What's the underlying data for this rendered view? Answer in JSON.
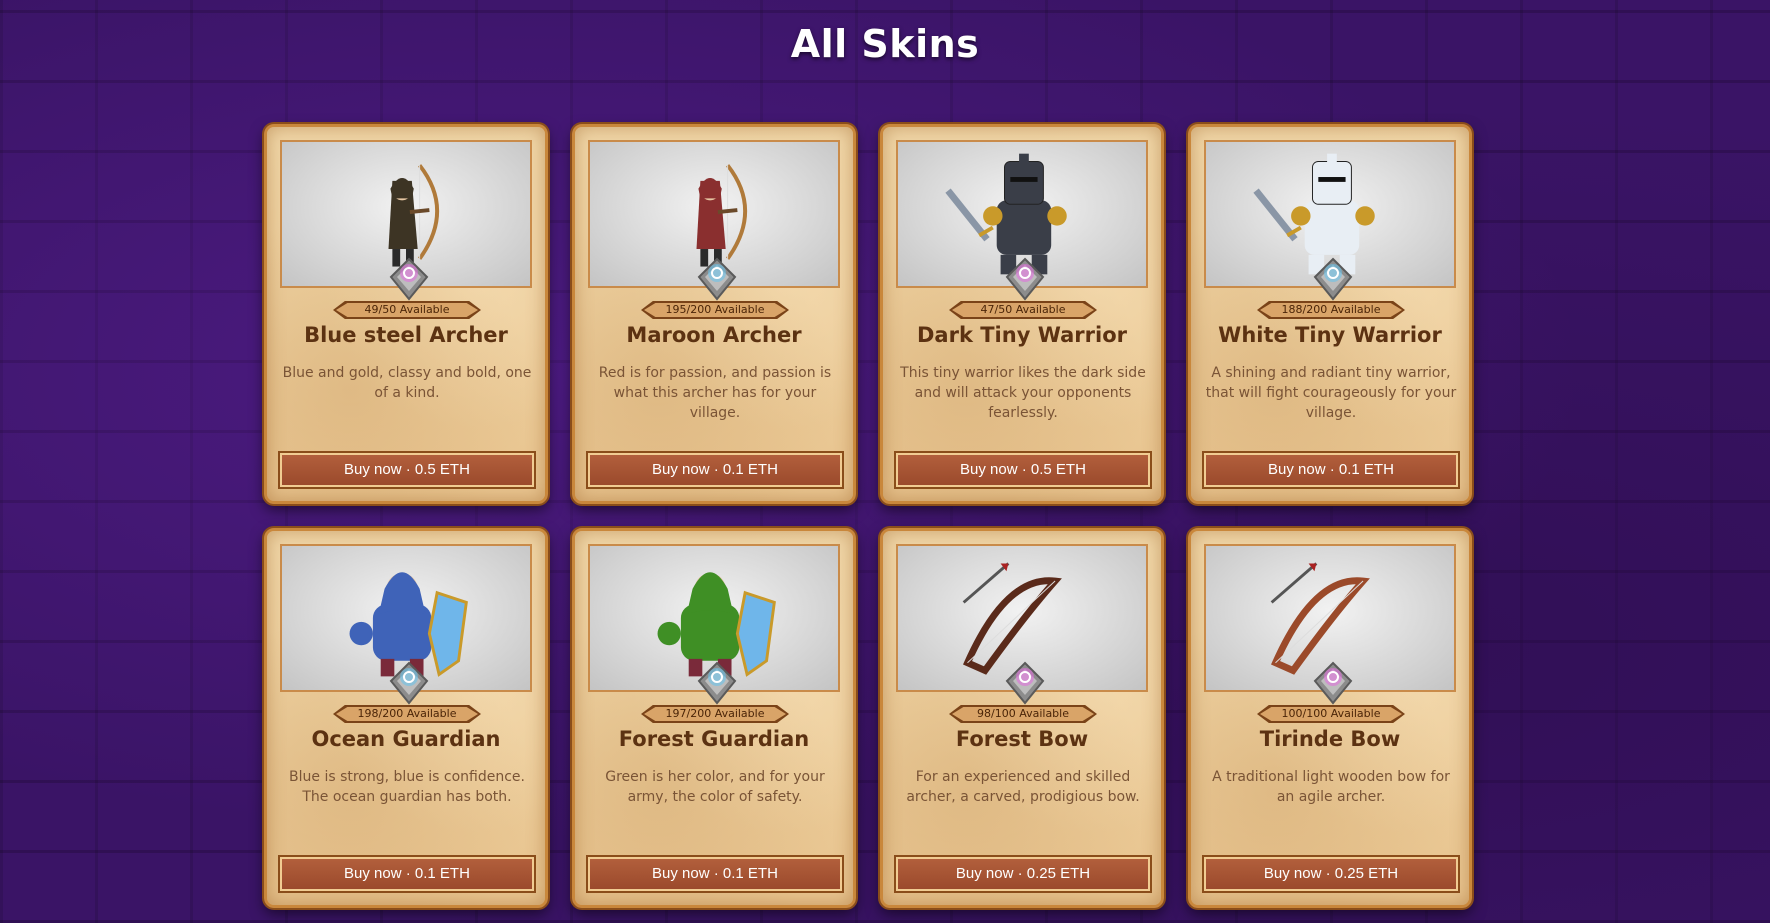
{
  "page": {
    "title": "All Skins"
  },
  "colors": {
    "background": "#3a1466",
    "button": "#a6553a",
    "card": "#ecd0a0",
    "rarity_epic": "#e46ce0",
    "rarity_rare": "#66c4ee"
  },
  "cards": [
    {
      "name": "Blue steel Archer",
      "availability": "49/50 Available",
      "description": "Blue and gold, classy and bold, one of a kind.",
      "button": "Buy now · 0.5 ETH",
      "icon": "archer-icon",
      "gem": "epic",
      "cloak": "#3d3424"
    },
    {
      "name": "Maroon Archer",
      "availability": "195/200 Available",
      "description": "Red is for passion, and passion is what this archer has for your village.",
      "button": "Buy now · 0.1 ETH",
      "icon": "archer-icon",
      "gem": "rare",
      "cloak": "#8a2f2f"
    },
    {
      "name": "Dark Tiny Warrior",
      "availability": "47/50 Available",
      "description": "This tiny warrior likes the dark side and will attack your opponents fearlessly.",
      "button": "Buy now · 0.5 ETH",
      "icon": "warrior-icon",
      "gem": "epic",
      "cloak": "#3a3e48"
    },
    {
      "name": "White Tiny Warrior",
      "availability": "188/200 Available",
      "description": "A shining and radiant tiny warrior, that will fight courageously for your village.",
      "button": "Buy now · 0.1 ETH",
      "icon": "warrior-icon",
      "gem": "rare",
      "cloak": "#e8eef4"
    },
    {
      "name": "Ocean Guardian",
      "availability": "198/200 Available",
      "description": "Blue is strong, blue is confidence. The ocean guardian has both.",
      "button": "Buy now · 0.1 ETH",
      "icon": "guardian-icon",
      "gem": "rare",
      "cloak": "#3f63b8"
    },
    {
      "name": "Forest Guardian",
      "availability": "197/200 Available",
      "description": "Green is her color, and for your army, the color of safety.",
      "button": "Buy now · 0.1 ETH",
      "icon": "guardian-icon",
      "gem": "rare",
      "cloak": "#3f8f25"
    },
    {
      "name": "Forest Bow",
      "availability": "98/100 Available",
      "description": "For an experienced and skilled archer, a carved, prodigious bow.",
      "button": "Buy now · 0.25 ETH",
      "icon": "bow-icon",
      "gem": "epic",
      "cloak": "#5a2a1a"
    },
    {
      "name": "Tirinde Bow",
      "availability": "100/100 Available",
      "description": "A traditional light wooden bow for an agile archer.",
      "button": "Buy now · 0.25 ETH",
      "icon": "bow-icon",
      "gem": "epic",
      "cloak": "#9b4a2a"
    }
  ]
}
